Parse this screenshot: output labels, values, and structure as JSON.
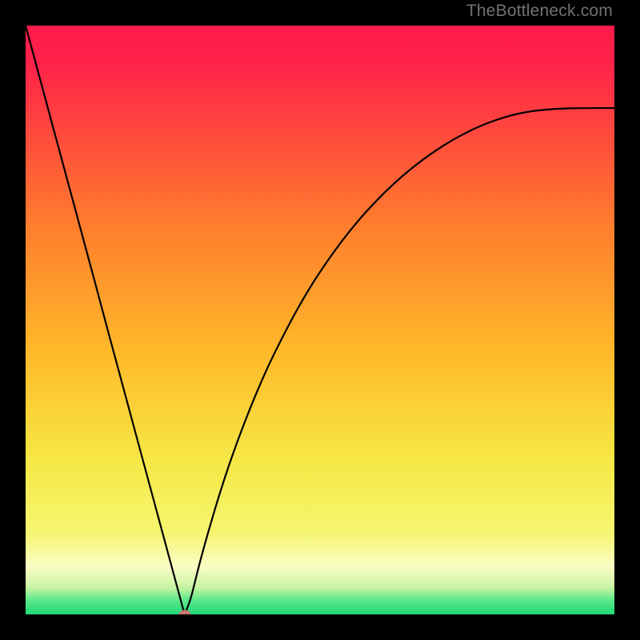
{
  "watermark": "TheBottleneck.com",
  "colors": {
    "black": "#000000",
    "red_top": "#ff1a4b",
    "orange_mid": "#ff9a26",
    "yellow": "#f7f455",
    "pale_yellow": "#fbfcb0",
    "green_bottom": "#22e07a",
    "marker": "#c77a6d",
    "curve": "#000000",
    "watermark_text": "#717171"
  },
  "chart_data": {
    "type": "line",
    "title": "",
    "xlabel": "",
    "ylabel": "",
    "xlim": [
      0,
      100
    ],
    "ylim": [
      0,
      100
    ],
    "x": [
      0,
      2,
      4,
      6,
      8,
      10,
      12,
      14,
      16,
      18,
      20,
      22,
      24,
      26,
      27,
      28,
      29,
      30,
      32,
      34,
      36,
      38,
      40,
      42,
      46,
      50,
      55,
      60,
      65,
      70,
      75,
      80,
      85,
      90,
      95,
      100
    ],
    "values": [
      100,
      92.6,
      85.2,
      77.8,
      70.4,
      63.0,
      55.6,
      48.1,
      40.7,
      33.3,
      25.9,
      18.5,
      11.1,
      3.7,
      0.0,
      2.4,
      6.5,
      10.4,
      17.4,
      23.8,
      29.5,
      34.7,
      39.5,
      43.9,
      51.7,
      58.3,
      65.2,
      70.8,
      75.4,
      79.1,
      82.0,
      84.1,
      85.4,
      85.9,
      86.0,
      86.0
    ],
    "minimum": {
      "x": 27,
      "y": 0
    },
    "legend": [],
    "grid": false
  },
  "gradient_stops": [
    {
      "pct": 0,
      "color": "#ff1a4b"
    },
    {
      "pct": 7,
      "color": "#ff2449"
    },
    {
      "pct": 33,
      "color": "#ff7a2e"
    },
    {
      "pct": 55,
      "color": "#ffb829"
    },
    {
      "pct": 74,
      "color": "#f6e846"
    },
    {
      "pct": 86,
      "color": "#f6f66f"
    },
    {
      "pct": 92,
      "color": "#fafdc6"
    },
    {
      "pct": 95.5,
      "color": "#c6f3a2"
    },
    {
      "pct": 97.5,
      "color": "#5de98a"
    },
    {
      "pct": 100,
      "color": "#1fd877"
    }
  ]
}
